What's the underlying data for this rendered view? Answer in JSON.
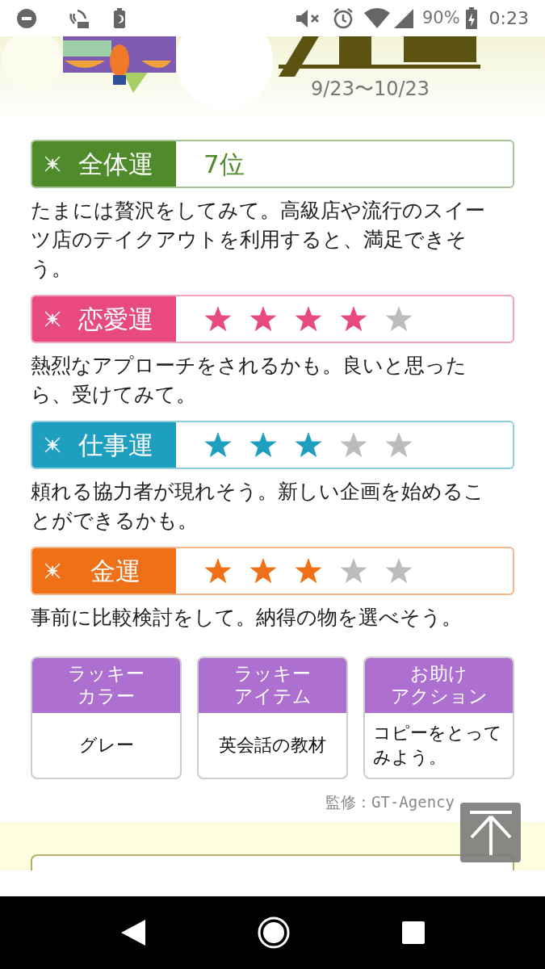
{
  "status_bar": {
    "battery": "90%",
    "time": "0:23"
  },
  "header": {
    "date_range": "9/23〜10/23"
  },
  "fortunes": [
    {
      "label": "全体運",
      "kind": "rank",
      "value": "7位",
      "color": "#4f8a2b",
      "description": "たまには贅沢をしてみて。高級店や流行のスイーツ店のテイクアウトを利用すると、満足できそう。"
    },
    {
      "label": "恋愛運",
      "kind": "stars",
      "stars": 4,
      "color": "#e84a7e",
      "description": "熱烈なアプローチをされるかも。良いと思ったら、受けてみて。"
    },
    {
      "label": "仕事運",
      "kind": "stars",
      "stars": 3,
      "color": "#1e9fc0",
      "description": "頼れる協力者が現れそう。新しい企画を始めることができるかも。"
    },
    {
      "label": "金運",
      "kind": "stars",
      "stars": 3,
      "color": "#f07018",
      "description": "事前に比較検討をして。納得の物を選べそう。"
    }
  ],
  "lucky": [
    {
      "title_lines": [
        "ラッキー",
        "カラー"
      ],
      "value": "グレー"
    },
    {
      "title_lines": [
        "ラッキー",
        "アイテム"
      ],
      "value": "英会話の教材"
    },
    {
      "title_lines": [
        "お助け",
        "アクション"
      ],
      "value": "コピーをとってみよう。"
    }
  ],
  "credit": "監修：GT-Agency"
}
